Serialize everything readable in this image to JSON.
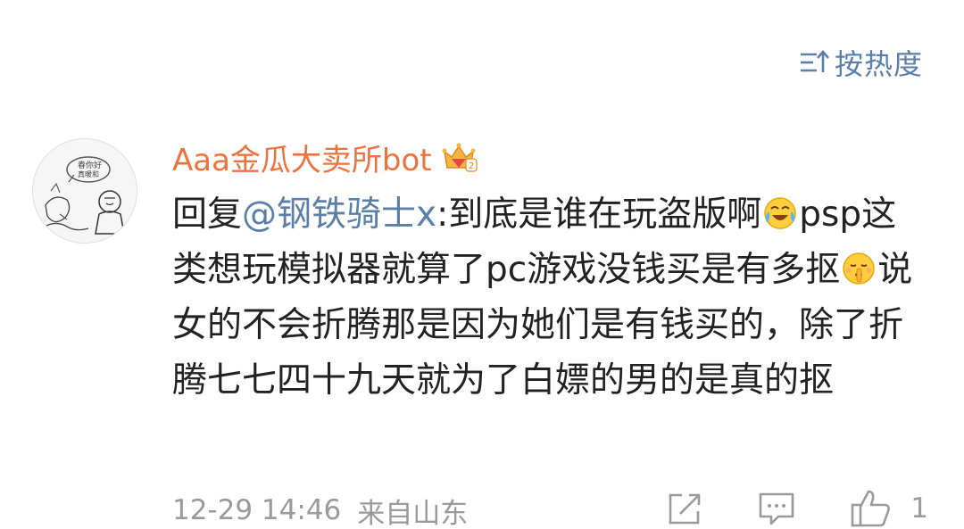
{
  "sort": {
    "label": "按热度",
    "icon": "sort-icon",
    "color": "#5b7fa8"
  },
  "comment": {
    "avatar_icon": "avatar-sketch-image",
    "username": "Aaa金瓜大卖所bot",
    "username_color": "#eb7340",
    "badge_icon": "vip-crown-badge-icon",
    "body": {
      "reply_prefix": "回复",
      "mention": "@钢铁骑士x",
      "part1": ":到底是谁在玩盗版啊",
      "emoji1": "laughing-crying-emoji-icon",
      "part2": "psp这类想玩模拟器就算了pc游戏没钱买是有多抠",
      "emoji2": "shush-emoji-icon",
      "part3": "说女的不会折腾那是因为她们是有钱买的，除了折腾七七四十九天就为了白嫖的男的是真的抠"
    },
    "timestamp": "12-29 14:46",
    "source": "来自山东",
    "actions": {
      "share_icon": "share-icon",
      "comment_icon": "comment-icon",
      "like_icon": "thumbs-up-icon",
      "like_count": "1"
    }
  }
}
